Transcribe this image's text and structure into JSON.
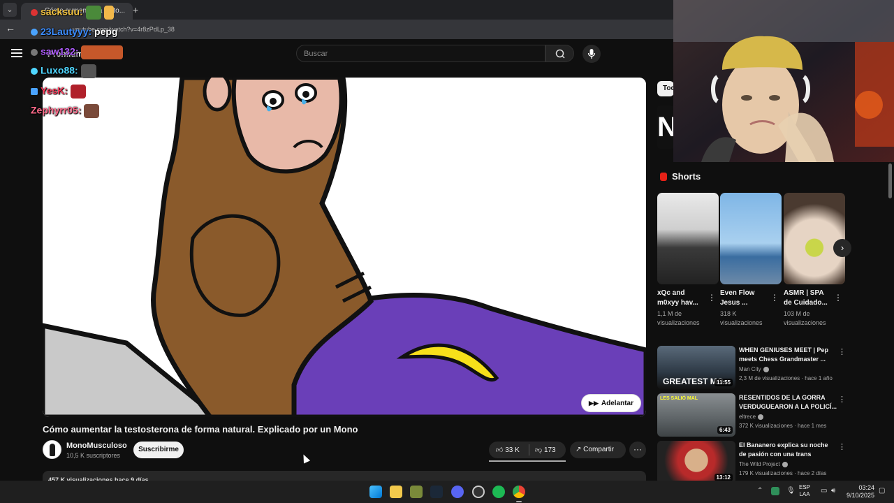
{
  "browser": {
    "tab_title": "Cómo aumentar la testo...",
    "url": "youtube.com/watch?v=4r8zPdLp_38"
  },
  "youtube": {
    "logo_suffix": "Premium",
    "search_placeholder": "Buscar"
  },
  "video": {
    "title": "Cómo aumentar la testosterona de forma natural. Explicado por un Mono",
    "skip_label": "Adelantar",
    "channel_name": "MonoMusculoso",
    "channel_subs": "10,5 K suscriptores",
    "subscribe_label": "Suscribirme",
    "likes": "33 K",
    "dislikes": "173",
    "share_label": "Compartir",
    "desc_stats": "457 K visualizaciones  hace 9 días"
  },
  "sidebar": {
    "chip_all": "Todo",
    "shorts_heading": "Shorts",
    "shorts": [
      {
        "title": "xQc and m0xyy hav...",
        "views_line1": "1,1 M de",
        "views_line2": "visualizaciones"
      },
      {
        "title": "Even Flow Jesus ...",
        "views_line1": "318 K",
        "views_line2": "visualizaciones"
      },
      {
        "title": "ASMR | SPA de Cuidado...",
        "views_line1": "103 M de",
        "views_line2": "visualizaciones"
      }
    ],
    "recommended": [
      {
        "title": "WHEN GENIUSES MEET | Pep meets Chess Grandmaster ...",
        "channel": "Man City",
        "meta": "2,3 M de visualizaciones · hace 1 año",
        "duration": "11:55",
        "thumb_text": "GREATEST MO"
      },
      {
        "title": "RESENTIDOS DE LA GORRA VERDUGUEARON A LA POLICÍ...",
        "channel": "eltrece",
        "meta": "372 K visualizaciones · hace 1 mes",
        "duration": "6:43",
        "thumb_text": "LES SALIÓ MAL"
      },
      {
        "title": "El Bananero explica su noche de pasión con una trans",
        "channel": "The Wild Project",
        "meta": "179 K visualizaciones · hace 2 días",
        "duration": "13:12",
        "thumb_text": ""
      }
    ]
  },
  "chat": [
    {
      "user": "sacksuu:",
      "message": "",
      "color": "#f5c542"
    },
    {
      "user": "23Lautyyy:",
      "message": "pepg",
      "color": "#3b8cff"
    },
    {
      "user": "saw132:",
      "message": "",
      "color": "#b05cff"
    },
    {
      "user": "Luxo88:",
      "message": "",
      "color": "#4fd6ff"
    },
    {
      "user": "YesK:",
      "message": "",
      "color": "#ff3b5c"
    },
    {
      "user": "Zephyrr05:",
      "message": "",
      "color": "#ff6a8a"
    }
  ],
  "taskbar": {
    "lang_line1": "ESP",
    "lang_line2": "LAA",
    "time": "03:24",
    "date": "9/10/2025"
  },
  "colors": {
    "bg": "#0f0f0f",
    "surface": "#272727",
    "banana": "#f7e01a",
    "blanket": "#6a3fb8",
    "monkey": "#8a5a2b"
  }
}
